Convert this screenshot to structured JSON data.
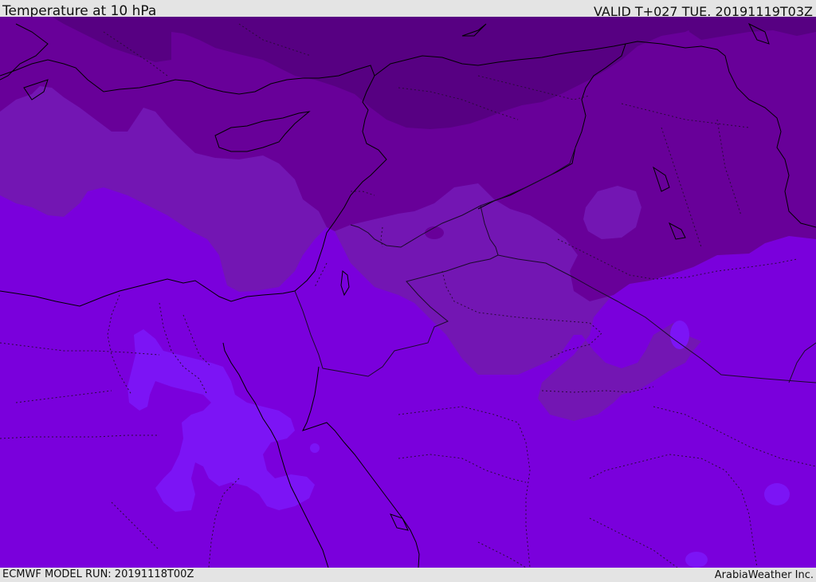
{
  "header": {
    "title": "Temperature at 10 hPa",
    "valid": "VALID T+027 TUE. 20191119T03Z"
  },
  "footer": {
    "model_run": "ECMWF MODEL RUN: 20191118T00Z",
    "credit": "ArabiaWeather Inc."
  },
  "colors": {
    "band_darkest": "#570082",
    "band_dark": "#680099",
    "band_mid": "#7316b3",
    "band_base": "#7a00dc",
    "band_light": "#7c14f5",
    "band_lightest": "#7400ff",
    "coastline": "#000000",
    "border": "#1a0a2a"
  }
}
